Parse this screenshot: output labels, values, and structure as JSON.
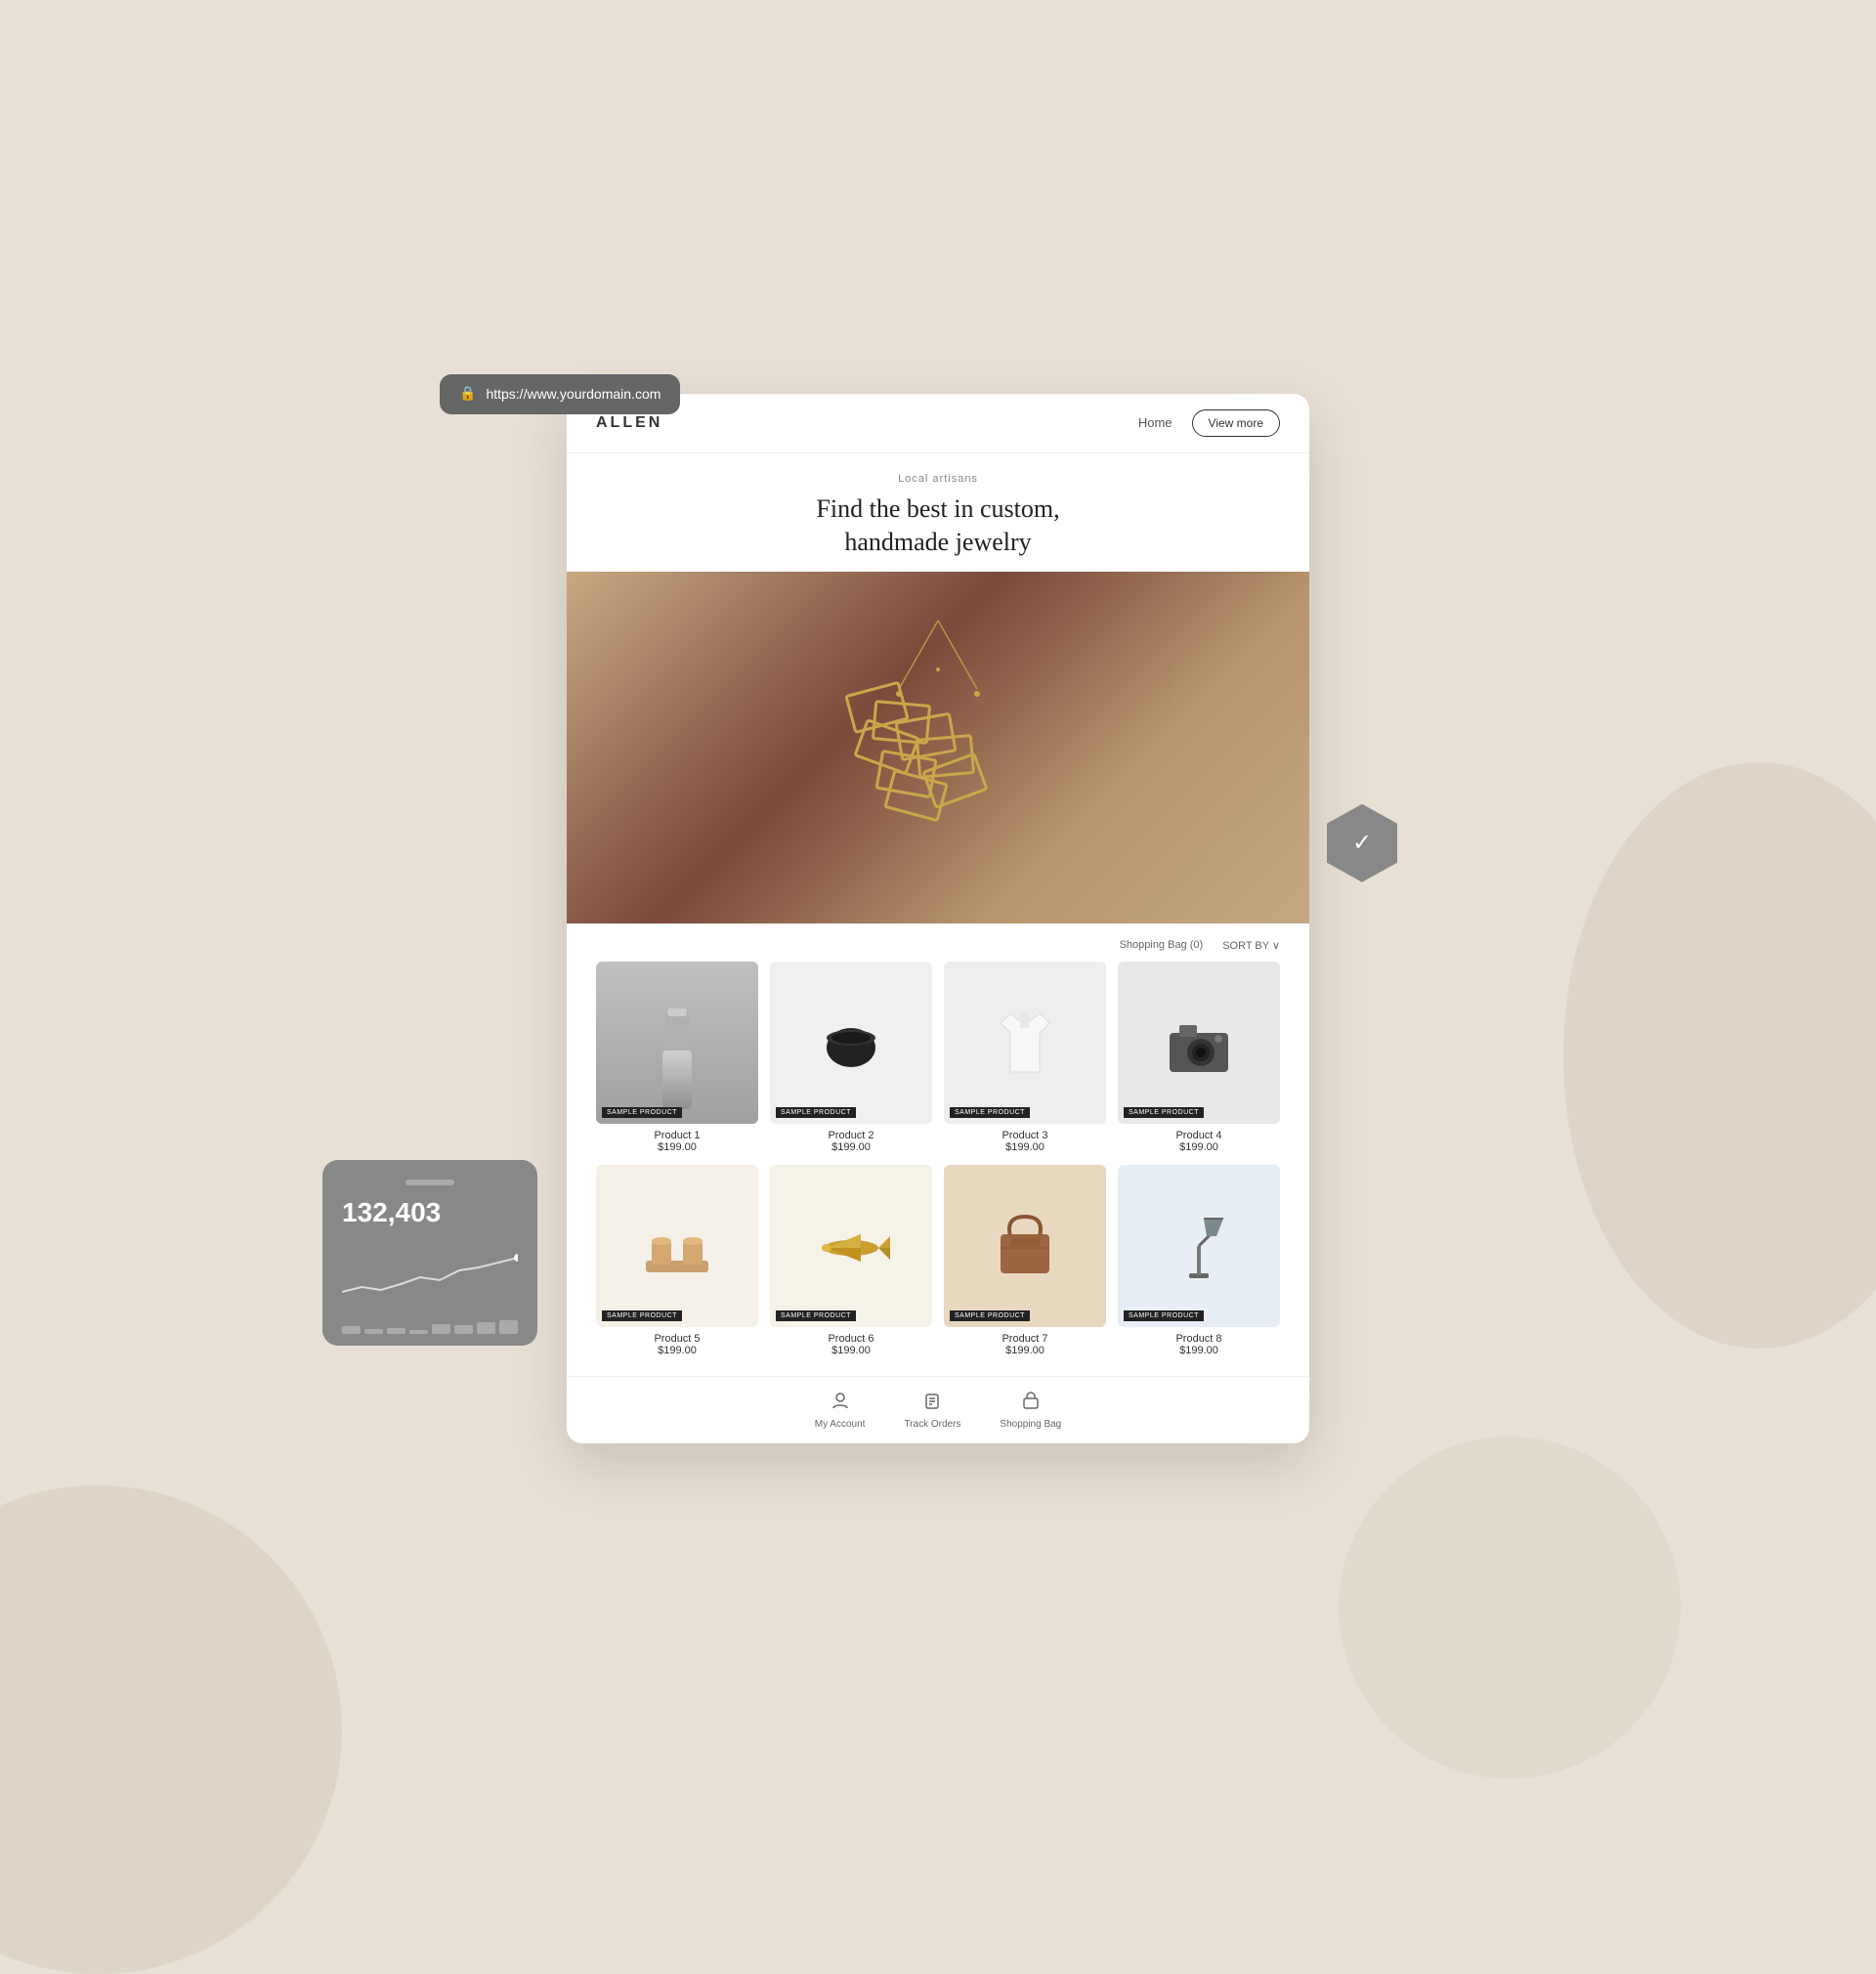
{
  "page": {
    "background_color": "#e8e0d5"
  },
  "url_bar": {
    "url": "https://www.yourdomain.com",
    "lock_icon": "🔒"
  },
  "navbar": {
    "brand": "ALLEN",
    "home_link": "Home",
    "view_more_button": "View more"
  },
  "hero": {
    "subtitle": "Local artisans",
    "heading_line1": "Find the best in custom,",
    "heading_line2": "handmade jewelry"
  },
  "products_header": {
    "bag_label": "Shopping Bag (0)",
    "sort_label": "SORT BY ∨"
  },
  "products": [
    {
      "id": 1,
      "name": "Product 1",
      "price": "$199.00",
      "badge": "SAMPLE PRODUCT",
      "image_type": "tumbler"
    },
    {
      "id": 2,
      "name": "Product 2",
      "price": "$199.00",
      "badge": "SAMPLE PRODUCT",
      "image_type": "coffee"
    },
    {
      "id": 3,
      "name": "Product 3",
      "price": "$199.00",
      "badge": "SAMPLE PRODUCT",
      "image_type": "shirt"
    },
    {
      "id": 4,
      "name": "Product 4",
      "price": "$199.00",
      "badge": "SAMPLE PRODUCT",
      "image_type": "camera"
    },
    {
      "id": 5,
      "name": "Product 5",
      "price": "$199.00",
      "badge": "SAMPLE PRODUCT",
      "image_type": "cups"
    },
    {
      "id": 6,
      "name": "Product 6",
      "price": "$199.00",
      "badge": "SAMPLE PRODUCT",
      "image_type": "plane"
    },
    {
      "id": 7,
      "name": "Product 7",
      "price": "$199.00",
      "badge": "SAMPLE PRODUCT",
      "image_type": "bag"
    },
    {
      "id": 8,
      "name": "Product 8",
      "price": "$199.00",
      "badge": "SAMPLE PRODUCT",
      "image_type": "lamp"
    }
  ],
  "stats_widget": {
    "number": "132,403",
    "chart_data": [
      30,
      20,
      25,
      15,
      40,
      35,
      45,
      55,
      50,
      65
    ]
  },
  "bottom_nav": [
    {
      "label": "My Account",
      "icon": "person"
    },
    {
      "label": "Track Orders",
      "icon": "box"
    },
    {
      "label": "Shopping Bag",
      "icon": "bag"
    }
  ]
}
